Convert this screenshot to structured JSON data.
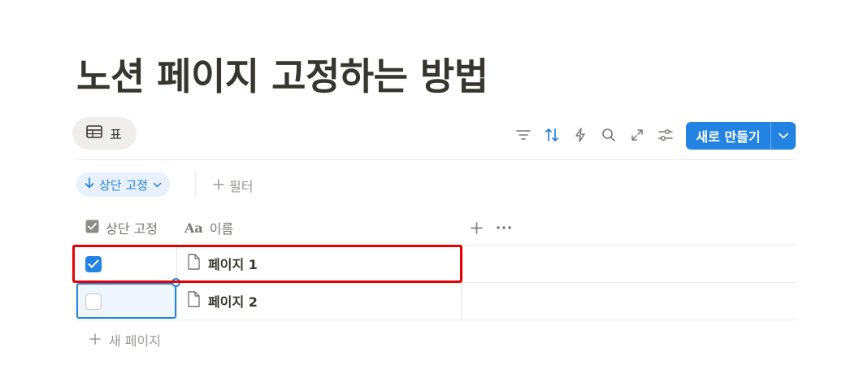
{
  "page": {
    "title": "노션 페이지 고정하는 방법"
  },
  "view": {
    "tab_label": "표",
    "icon": "table-icon"
  },
  "toolbar": {
    "icons": [
      "filter-icon",
      "sort-icon",
      "automation-icon",
      "search-icon",
      "expand-icon",
      "settings-icon"
    ],
    "new_button_label": "새로 만들기",
    "accent": "#2383e2"
  },
  "filters": {
    "sort_chip_label": "상단 고정",
    "add_filter_label": "필터"
  },
  "table": {
    "columns": [
      {
        "label": "상단 고정",
        "icon": "checkbox-icon"
      },
      {
        "label": "이름",
        "icon": "text-aa-icon"
      }
    ],
    "rows": [
      {
        "pinned": true,
        "name": "페이지 1"
      },
      {
        "pinned": false,
        "name": "페이지 2"
      }
    ],
    "new_page_label": "새 페이지"
  },
  "annotation": {
    "highlight_color": "#e60000"
  }
}
